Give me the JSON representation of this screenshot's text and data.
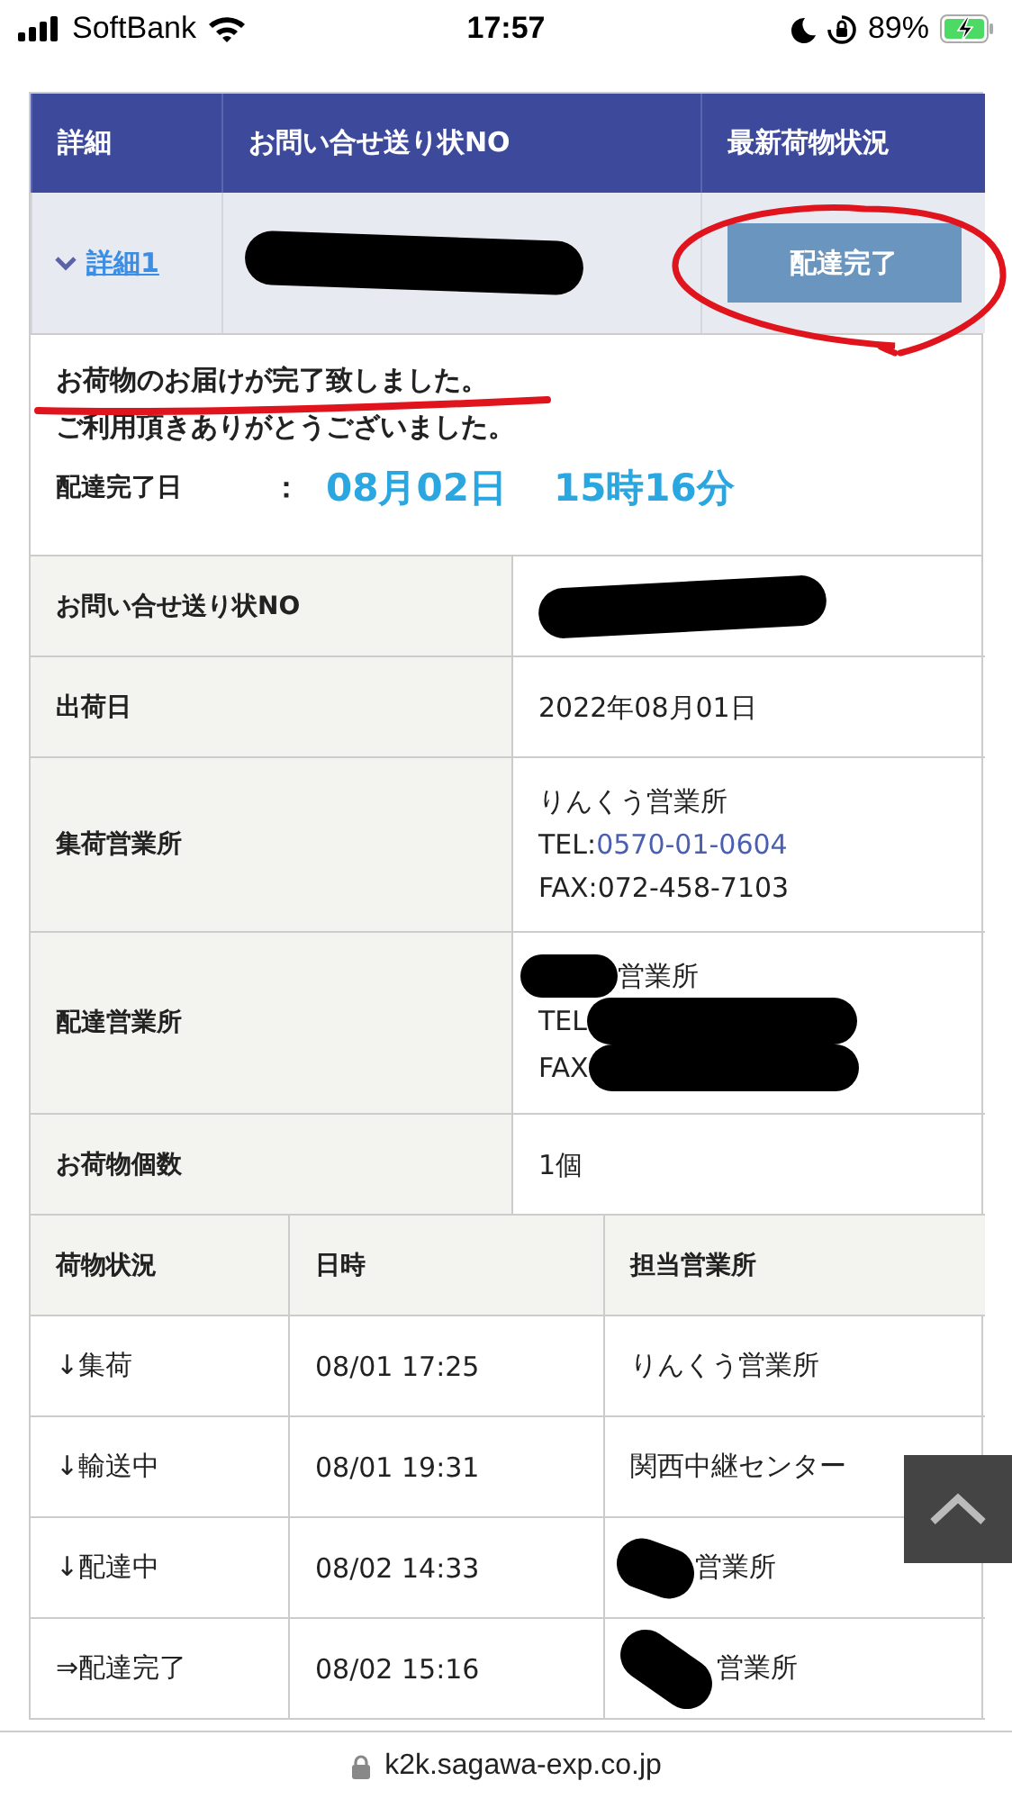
{
  "status_bar": {
    "carrier": "SoftBank",
    "time": "17:57",
    "battery": "89%"
  },
  "summary_table": {
    "columns": [
      "詳細",
      "お問い合せ送り状NO",
      "最新荷物状況"
    ],
    "detail_link": "詳細1",
    "expanded": true,
    "number_redacted": true,
    "status_button": "配達完了"
  },
  "message": {
    "lines": [
      "お荷物のお届けが完了致しました。",
      "ご利用頂きありがとうございました。"
    ],
    "date_label": "配達完了日",
    "separator": "：",
    "date": "08月02日",
    "time": "15時16分"
  },
  "info_rows": [
    {
      "label": "お問い合せ送り状NO",
      "redacted": true
    },
    {
      "label": "出荷日",
      "lines": [
        {
          "text": "2022年08月01日"
        }
      ]
    },
    {
      "label": "集荷営業所",
      "lines": [
        {
          "text": "りんくう営業所"
        },
        {
          "text": "TEL:",
          "link": "0570-01-0604"
        },
        {
          "text": "FAX:072-458-7103"
        }
      ]
    },
    {
      "label": "配達営業所",
      "lines": [
        {
          "text": "営業所",
          "redacted": true,
          "redaction_first": true
        },
        {
          "text": "TEL",
          "redacted": true,
          "redaction_first": false
        },
        {
          "text": "FAX",
          "redacted": true,
          "redaction_first": false
        }
      ]
    },
    {
      "label": "お荷物個数",
      "lines": [
        {
          "text": "1個"
        }
      ]
    }
  ],
  "history": {
    "columns": [
      "荷物状況",
      "日時",
      "担当営業所"
    ],
    "rows": [
      {
        "status": "↓集荷",
        "datetime": "08/01 17:25",
        "office": "りんくう営業所",
        "redacted": false
      },
      {
        "status": "↓輸送中",
        "datetime": "08/01 19:31",
        "office": "関西中継センター",
        "redacted": false
      },
      {
        "status": "↓配達中",
        "datetime": "08/02 14:33",
        "office": "営業所",
        "redacted": true
      },
      {
        "status": "⇒配達完了",
        "datetime": "08/02 15:16",
        "office": "営業所",
        "redacted": true
      }
    ]
  },
  "address_bar": {
    "url": "k2k.sagawa-exp.co.jp"
  }
}
